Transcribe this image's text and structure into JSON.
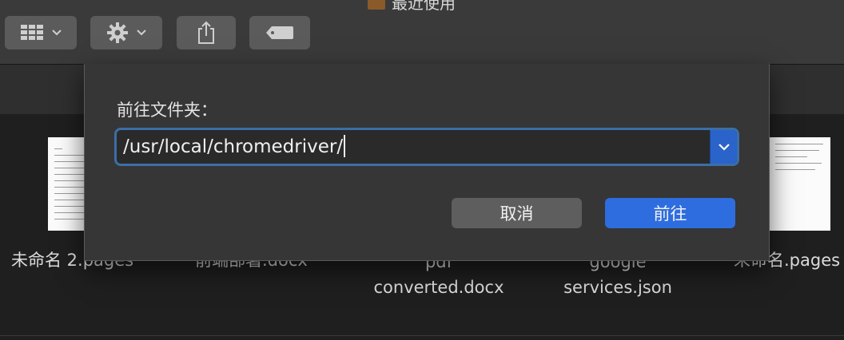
{
  "window": {
    "title": "最近使用"
  },
  "toolbar": {
    "buttons": [
      {
        "name": "view-options",
        "icon": "grid-icon"
      },
      {
        "name": "action",
        "icon": "gear-icon"
      },
      {
        "name": "share",
        "icon": "share-icon"
      },
      {
        "name": "tags",
        "icon": "tag-icon"
      }
    ]
  },
  "files": [
    {
      "name": "未命名 2.pages"
    },
    {
      "name": "前端部署.docx"
    },
    {
      "name_line1": "pdf",
      "name_line2": "converted.docx"
    },
    {
      "name_line1": "google",
      "name_line2": "services.json"
    },
    {
      "name": "未命名.pages"
    }
  ],
  "dialog": {
    "label": "前往文件夹：",
    "path_value": "/usr/local/chromedriver/",
    "cancel_label": "取消",
    "go_label": "前往",
    "colors": {
      "primary": "#2e6de0",
      "focus_ring": "#3c6ea8"
    }
  }
}
